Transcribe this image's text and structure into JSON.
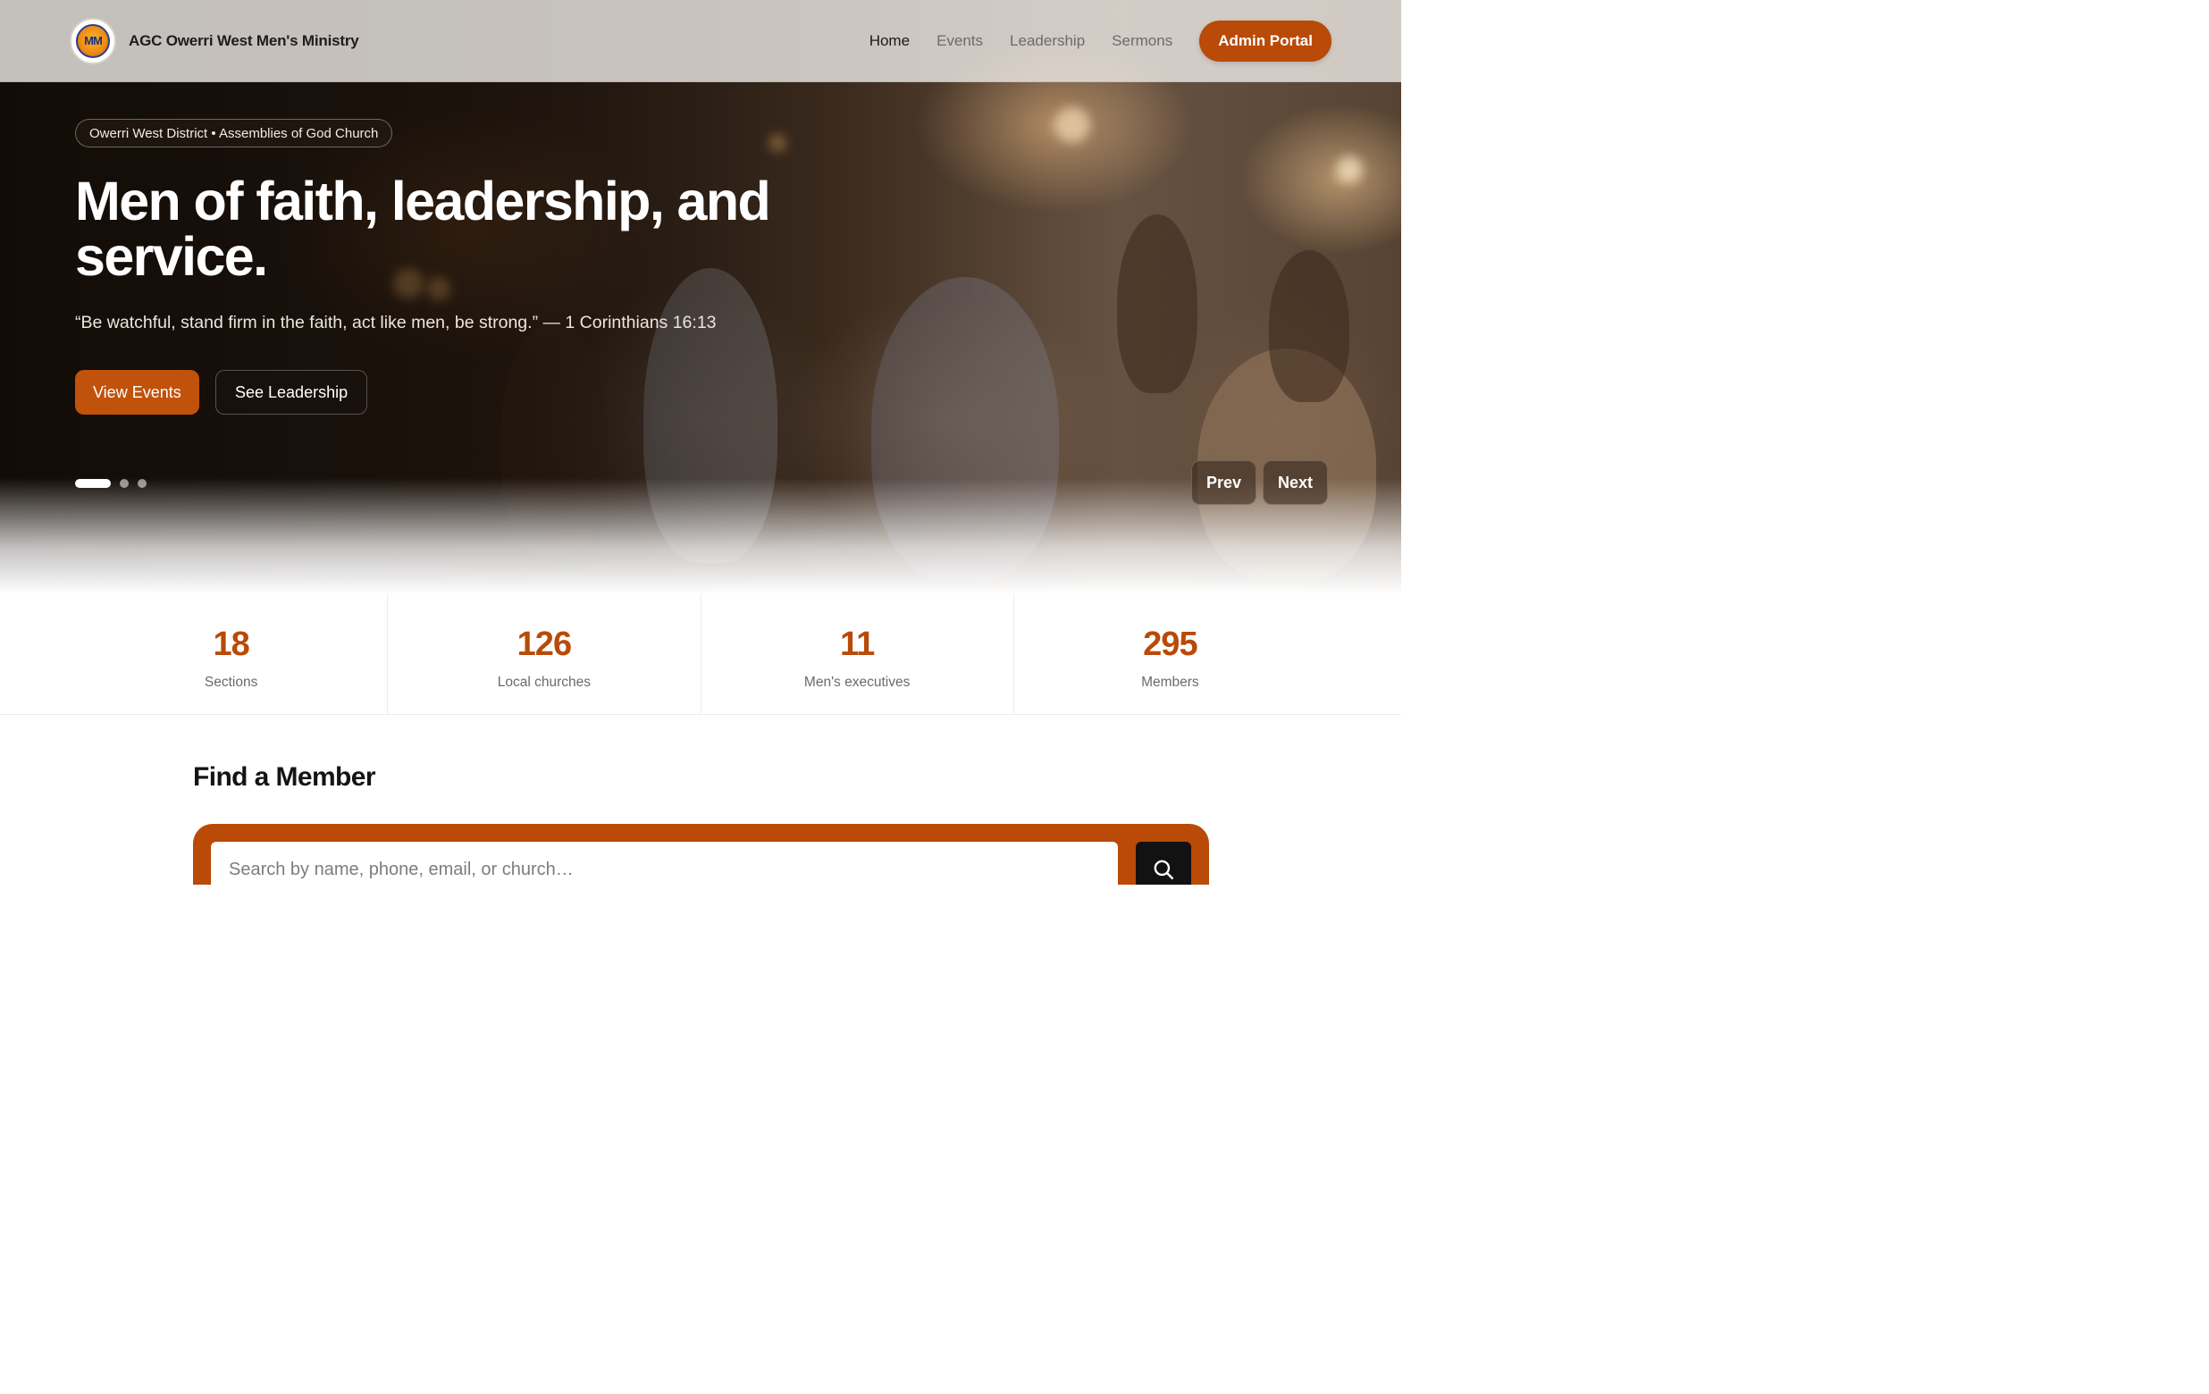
{
  "header": {
    "brand_name": "AGC Owerri West Men's Ministry",
    "logo_text": "MM",
    "nav": [
      {
        "label": "Home",
        "active": true
      },
      {
        "label": "Events",
        "active": false
      },
      {
        "label": "Leadership",
        "active": false
      },
      {
        "label": "Sermons",
        "active": false
      }
    ],
    "admin_button": "Admin Portal"
  },
  "hero": {
    "pill": "Owerri West District • Assemblies of God Church",
    "headline": "Men of faith, leadership, and service.",
    "verse": "“Be watchful, stand firm in the faith, act like men, be strong.” — 1 Corinthians 16:13",
    "primary_button": "View Events",
    "secondary_button": "See Leadership",
    "slides_total": 3,
    "slide_active": 1,
    "prev_label": "Prev",
    "next_label": "Next"
  },
  "stats": [
    {
      "value": "18",
      "label": "Sections"
    },
    {
      "value": "126",
      "label": "Local churches"
    },
    {
      "value": "11",
      "label": "Men's executives"
    },
    {
      "value": "295",
      "label": "Members"
    }
  ],
  "find_member": {
    "title": "Find a Member",
    "placeholder": "Search by name, phone, email, or church…"
  },
  "colors": {
    "accent": "#b94a07",
    "search_button": "#121212"
  },
  "icons": {
    "search": "search-icon"
  }
}
